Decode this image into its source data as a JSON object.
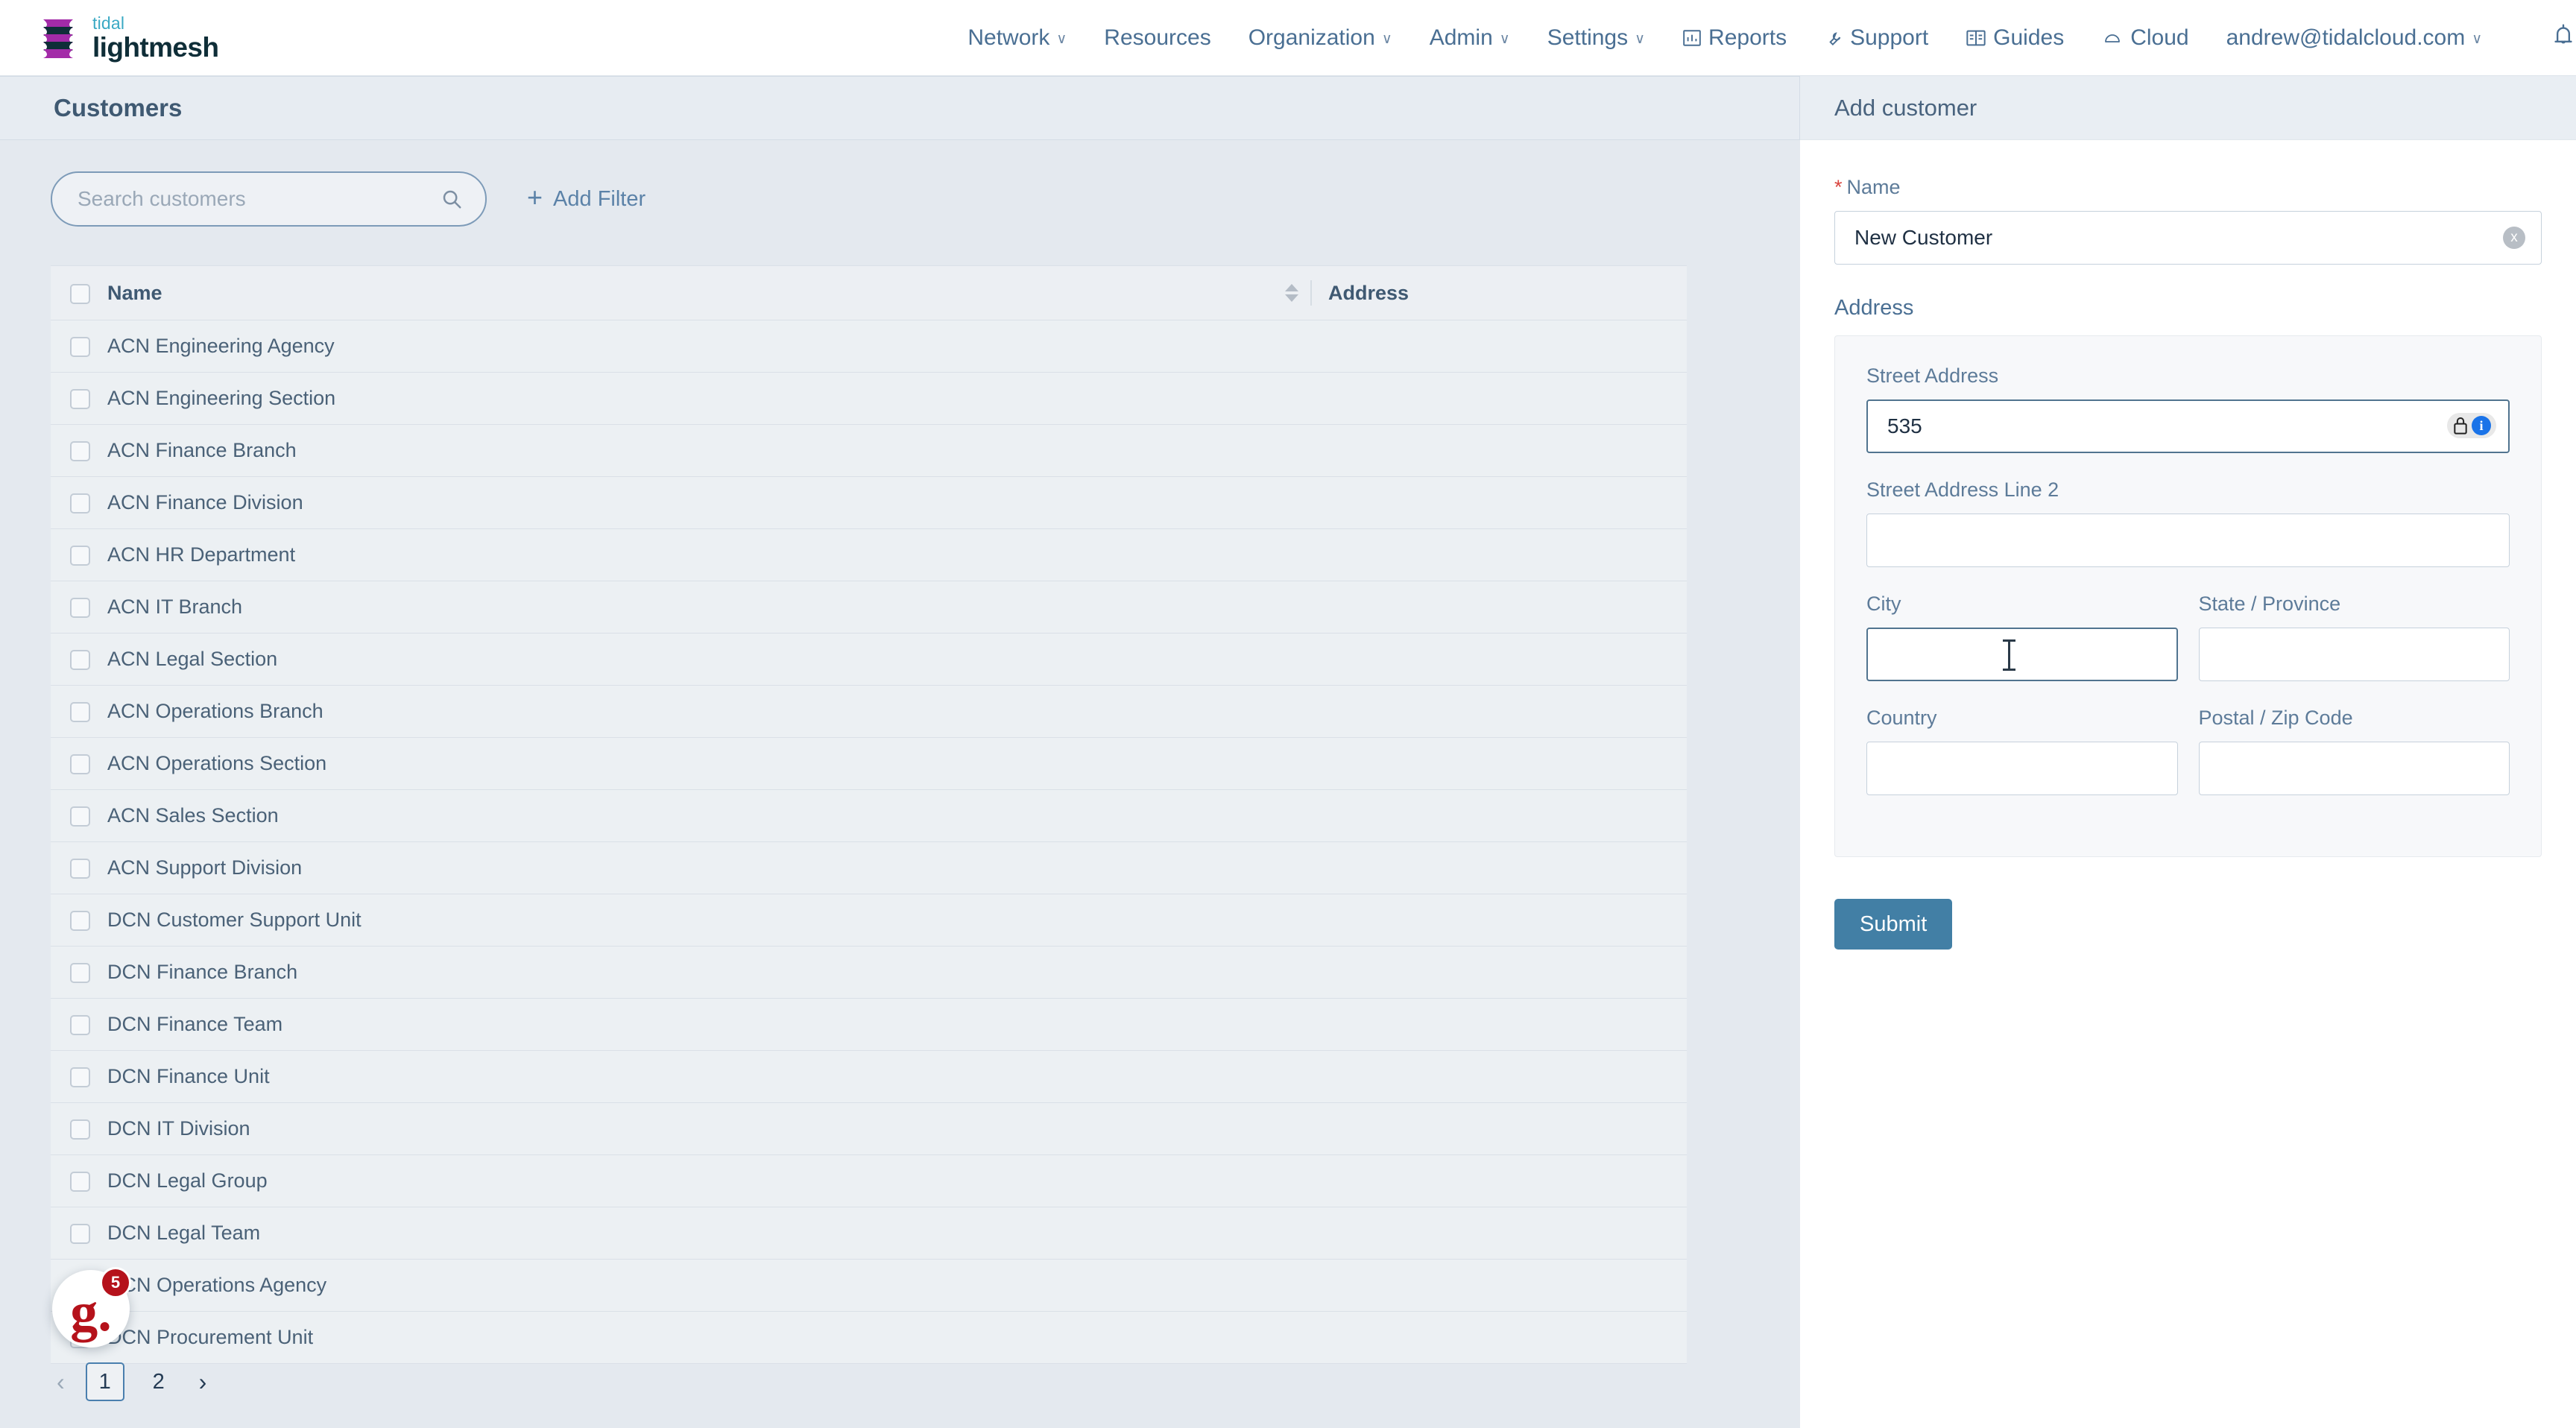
{
  "brand": {
    "line1": "tidal",
    "line2": "lightmesh",
    "logo_colors": {
      "purple": "#a32ba8",
      "dark": "#0f2e38",
      "teal": "#3aa9c4"
    }
  },
  "nav": {
    "items": [
      {
        "label": "Network",
        "caret": true,
        "icon": null
      },
      {
        "label": "Resources",
        "caret": false,
        "icon": null
      },
      {
        "label": "Organization",
        "caret": true,
        "icon": null
      },
      {
        "label": "Admin",
        "caret": true,
        "icon": null
      },
      {
        "label": "Settings",
        "caret": true,
        "icon": null
      }
    ],
    "right_items": [
      {
        "label": "Reports",
        "icon": "chart-bar-icon",
        "caret": false
      },
      {
        "label": "Support",
        "icon": "wrench-icon",
        "caret": false
      },
      {
        "label": "Guides",
        "icon": "book-icon",
        "caret": false
      },
      {
        "label": "Cloud",
        "icon": "cloud-icon",
        "caret": false
      },
      {
        "label": "andrew@tidalcloud.com",
        "icon": null,
        "caret": true
      }
    ],
    "bell_icon": "bell-icon",
    "chevron_glyph": "∨"
  },
  "page": {
    "title": "Customers"
  },
  "search": {
    "placeholder": "Search customers",
    "value": "",
    "icon": "search-icon"
  },
  "add_filter": {
    "label": "Add Filter",
    "plus": "+"
  },
  "table": {
    "columns": [
      {
        "key": "checkbox",
        "label": ""
      },
      {
        "key": "name",
        "label": "Name",
        "sortable": false
      },
      {
        "key": "address",
        "label": "Address",
        "sortable": true
      }
    ],
    "rows": [
      {
        "name": "ACN Engineering Agency",
        "address": ""
      },
      {
        "name": "ACN Engineering Section",
        "address": ""
      },
      {
        "name": "ACN Finance Branch",
        "address": ""
      },
      {
        "name": "ACN Finance Division",
        "address": ""
      },
      {
        "name": "ACN HR Department",
        "address": ""
      },
      {
        "name": "ACN IT Branch",
        "address": ""
      },
      {
        "name": "ACN Legal Section",
        "address": ""
      },
      {
        "name": "ACN Operations Branch",
        "address": ""
      },
      {
        "name": "ACN Operations Section",
        "address": ""
      },
      {
        "name": "ACN Sales Section",
        "address": ""
      },
      {
        "name": "ACN Support Division",
        "address": ""
      },
      {
        "name": "DCN Customer Support Unit",
        "address": ""
      },
      {
        "name": "DCN Finance Branch",
        "address": ""
      },
      {
        "name": "DCN Finance Team",
        "address": ""
      },
      {
        "name": "DCN Finance Unit",
        "address": ""
      },
      {
        "name": "DCN IT Division",
        "address": ""
      },
      {
        "name": "DCN Legal Group",
        "address": ""
      },
      {
        "name": "DCN Legal Team",
        "address": ""
      },
      {
        "name": "DCN Operations Agency",
        "address": ""
      },
      {
        "name": "DCN Procurement Unit",
        "address": ""
      }
    ]
  },
  "pagination": {
    "prev_glyph": "‹",
    "next_glyph": "›",
    "pages": [
      "1",
      "2"
    ],
    "current": "1"
  },
  "help_widget": {
    "letter": "g.",
    "badge": "5",
    "color": "#b5121b"
  },
  "form": {
    "title": "Add customer",
    "name_field": {
      "label": "Name",
      "required_marker": "*",
      "value": "New Customer",
      "placeholder": "",
      "clear_glyph": "x"
    },
    "address_section_label": "Address",
    "fields": [
      {
        "key": "street",
        "label": "Street Address",
        "value": "535",
        "placeholder": "",
        "focused": true,
        "autofill_icons": [
          "lock-icon",
          "info-icon"
        ]
      },
      {
        "key": "street2",
        "label": "Street Address Line 2",
        "value": "",
        "placeholder": "",
        "focused": false
      },
      {
        "key": "city",
        "label": "City",
        "value": "",
        "placeholder": "",
        "focused": true
      },
      {
        "key": "state",
        "label": "State / Province",
        "value": "",
        "placeholder": "",
        "focused": false
      },
      {
        "key": "country",
        "label": "Country",
        "value": "",
        "placeholder": "",
        "focused": false
      },
      {
        "key": "postal",
        "label": "Postal / Zip Code",
        "value": "",
        "placeholder": "",
        "focused": false
      }
    ],
    "submit_label": "Submit"
  },
  "colors": {
    "accent": "#427fa5",
    "nav_text": "#4a6f93",
    "page_bg": "#e4e9ef",
    "panel_bg": "#ffffff",
    "required_red": "#d9453f",
    "info_blue": "#1a73e8"
  }
}
